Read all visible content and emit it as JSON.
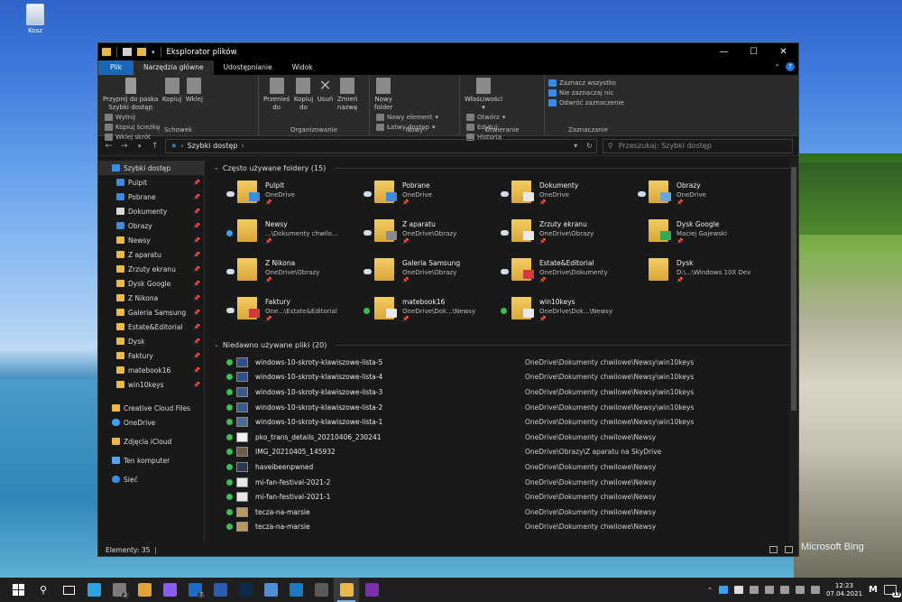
{
  "desktop": {
    "recycle_label": "Kosz",
    "wallpaper_credit": "Microsoft Bing"
  },
  "window": {
    "title": "Eksplorator plików",
    "controls": {
      "minimize": "—",
      "maximize": "☐",
      "close": "✕"
    }
  },
  "tabs": [
    {
      "label": "Plik",
      "kind": "file"
    },
    {
      "label": "Narzędzia główne",
      "kind": "active"
    },
    {
      "label": "Udostępnianie",
      "kind": ""
    },
    {
      "label": "Widok",
      "kind": ""
    }
  ],
  "ribbon": {
    "schowek": {
      "label": "Schowek",
      "pin_label_1": "Przypnij do paska",
      "pin_label_2": "Szybki dostęp",
      "copy": "Kopiuj",
      "paste": "Wklej",
      "cut": "Wytnij",
      "copy_path": "Kopiuj ścieżkę",
      "paste_shortcut": "Wklej skrót"
    },
    "organizowanie": {
      "label": "Organizowanie",
      "move_1": "Przenieś",
      "move_2": "do",
      "copy_to_1": "Kopiuj",
      "copy_to_2": "do",
      "delete": "Usuń",
      "rename_1": "Zmień",
      "rename_2": "nazwę"
    },
    "nowy": {
      "label": "Nowy",
      "new_folder_1": "Nowy",
      "new_folder_2": "folder",
      "new_item": "Nowy element",
      "easy_access": "Łatwy dostęp"
    },
    "otwieranie": {
      "label": "Otwieranie",
      "properties": "Właściwości",
      "open": "Otwórz",
      "edit": "Edytuj",
      "history": "Historia"
    },
    "zaznaczanie": {
      "label": "Zaznaczanie",
      "select_all": "Zaznacz wszystko",
      "select_none": "Nie zaznaczaj nic",
      "invert": "Odwróć zaznaczenie"
    }
  },
  "address": {
    "path": "Szybki dostęp",
    "search_placeholder": "Przeszukaj: Szybki dostęp"
  },
  "sidebar": {
    "quick_access": "Szybki dostęp",
    "items": [
      {
        "label": "Pulpit",
        "icon": "blue"
      },
      {
        "label": "Pobrane",
        "icon": "blue"
      },
      {
        "label": "Dokumenty",
        "icon": "doc"
      },
      {
        "label": "Obrazy",
        "icon": "blue"
      },
      {
        "label": "Newsy",
        "icon": ""
      },
      {
        "label": "Z aparatu",
        "icon": ""
      },
      {
        "label": "Zrzuty ekranu",
        "icon": ""
      },
      {
        "label": "Dysk Google",
        "icon": ""
      },
      {
        "label": "Z Nikona",
        "icon": ""
      },
      {
        "label": "Galeria Samsung",
        "icon": ""
      },
      {
        "label": "Estate&Editorial",
        "icon": ""
      },
      {
        "label": "Dysk",
        "icon": ""
      },
      {
        "label": "Faktury",
        "icon": ""
      },
      {
        "label": "matebook16",
        "icon": ""
      },
      {
        "label": "win10keys",
        "icon": ""
      }
    ],
    "roots": [
      {
        "label": "Creative Cloud Files",
        "icon": ""
      },
      {
        "label": "OneDrive",
        "icon": "cloud"
      },
      {
        "label": "Zdjęcia iCloud",
        "icon": ""
      },
      {
        "label": "Ten komputer",
        "icon": "pc"
      },
      {
        "label": "Sieć",
        "icon": "net"
      }
    ]
  },
  "frequent": {
    "header": "Często używane foldery (15)",
    "folders": [
      {
        "name": "Pulpit",
        "sub": "OneDrive",
        "status": "cloud",
        "overlay": "#3d8be0"
      },
      {
        "name": "Pobrane",
        "sub": "OneDrive",
        "status": "cloud",
        "overlay": "#3d8be0"
      },
      {
        "name": "Dokumenty",
        "sub": "OneDrive",
        "status": "cloud",
        "overlay": "#e8e8e8"
      },
      {
        "name": "Obrazy",
        "sub": "OneDrive",
        "status": "cloud",
        "overlay": "#6aa6d8"
      },
      {
        "name": "Newsy",
        "sub": "...\\Dokumenty chwilo...",
        "status": "sync",
        "overlay": ""
      },
      {
        "name": "Z aparatu",
        "sub": "OneDrive\\Obrazy",
        "status": "cloud",
        "overlay": "#8a8a8a"
      },
      {
        "name": "Zrzuty ekranu",
        "sub": "OneDrive\\Obrazy",
        "status": "cloud",
        "overlay": "#e8e8e8"
      },
      {
        "name": "Dysk Google",
        "sub": "Maciej Gajewski",
        "status": "",
        "overlay": "#34a853"
      },
      {
        "name": "Z Nikona",
        "sub": "OneDrive\\Obrazy",
        "status": "cloud",
        "overlay": ""
      },
      {
        "name": "Galeria Samsung",
        "sub": "OneDrive\\Obrazy",
        "status": "cloud",
        "overlay": ""
      },
      {
        "name": "Estate&Editorial",
        "sub": "OneDrive\\Dokumenty",
        "status": "cloud",
        "overlay": "#d23b3b"
      },
      {
        "name": "Dysk",
        "sub": "D:\\...\\Windows 10X Dev",
        "status": "",
        "overlay": ""
      },
      {
        "name": "Faktury",
        "sub": "One...\\Estate&Editorial",
        "status": "cloud",
        "overlay": "#d23b3b"
      },
      {
        "name": "matebook16",
        "sub": "OneDrive\\Dok...\\Newsy",
        "status": "ok",
        "overlay": "#e8e8e8"
      },
      {
        "name": "win10keys",
        "sub": "OneDrive\\Dok...\\Newsy",
        "status": "ok",
        "overlay": "#e8e8e8"
      }
    ]
  },
  "recent": {
    "header": "Niedawno używane pliki (20)",
    "files": [
      {
        "name": "windows-10-skroty-klawiszowe-lista-5",
        "path": "OneDrive\\Dokumenty chwilowe\\Newsy\\win10keys",
        "thumb": "#2d4f8a"
      },
      {
        "name": "windows-10-skroty-klawiszowe-lista-4",
        "path": "OneDrive\\Dokumenty chwilowe\\Newsy\\win10keys",
        "thumb": "#2d4f8a"
      },
      {
        "name": "windows-10-skroty-klawiszowe-lista-3",
        "path": "OneDrive\\Dokumenty chwilowe\\Newsy\\win10keys",
        "thumb": "#39598f"
      },
      {
        "name": "windows-10-skroty-klawiszowe-lista-2",
        "path": "OneDrive\\Dokumenty chwilowe\\Newsy\\win10keys",
        "thumb": "#39598f"
      },
      {
        "name": "windows-10-skroty-klawiszowe-lista-1",
        "path": "OneDrive\\Dokumenty chwilowe\\Newsy\\win10keys",
        "thumb": "#4a6a9a"
      },
      {
        "name": "pko_trans_details_20210406_230241",
        "path": "OneDrive\\Dokumenty chwilowe\\Newsy",
        "thumb": "#f2f2f2"
      },
      {
        "name": "IMG_20210405_145932",
        "path": "OneDrive\\Obrazy\\Z aparatu na SkyDrive",
        "thumb": "#6c5d4a"
      },
      {
        "name": "haveibeenpwned",
        "path": "OneDrive\\Dokumenty chwilowe\\Newsy",
        "thumb": "#2a3b4f"
      },
      {
        "name": "mi-fan-festival-2021-2",
        "path": "OneDrive\\Dokumenty chwilowe\\Newsy",
        "thumb": "#e6e6e6"
      },
      {
        "name": "mi-fan-festival-2021-1",
        "path": "OneDrive\\Dokumenty chwilowe\\Newsy",
        "thumb": "#e6e6e6"
      },
      {
        "name": "tecza-na-marsie",
        "path": "OneDrive\\Dokumenty chwilowe\\Newsy",
        "thumb": "#b99a5a"
      },
      {
        "name": "tecza-na-marsie",
        "path": "OneDrive\\Dokumenty chwilowe\\Newsy",
        "thumb": "#b99a5a"
      }
    ]
  },
  "status": {
    "items": "Elementy: 35"
  },
  "taskbar": {
    "apps": [
      {
        "name": "start",
        "color": "#ffffff",
        "badge": ""
      },
      {
        "name": "search",
        "color": "#ffffff",
        "badge": ""
      },
      {
        "name": "task-view",
        "color": "#ffffff",
        "badge": ""
      },
      {
        "name": "edge",
        "color": "#2fa1e0",
        "badge": ""
      },
      {
        "name": "mail",
        "color": "#7b7b7b",
        "badge": "2"
      },
      {
        "name": "slack",
        "color": "#e0a23a",
        "badge": ""
      },
      {
        "name": "messenger",
        "color": "#8a5cf0",
        "badge": ""
      },
      {
        "name": "outlook",
        "color": "#1f6cc7",
        "badge": "7"
      },
      {
        "name": "word",
        "color": "#2b5cb4",
        "badge": ""
      },
      {
        "name": "photoshop",
        "color": "#0c2a4a",
        "badge": ""
      },
      {
        "name": "chrome",
        "color": "#4f8fd8",
        "badge": ""
      },
      {
        "name": "trello",
        "color": "#1f79bf",
        "badge": ""
      },
      {
        "name": "calculator",
        "color": "#5a5a5a",
        "badge": ""
      },
      {
        "name": "explorer",
        "color": "#e9b949",
        "badge": ""
      },
      {
        "name": "onenote",
        "color": "#7b2fa8",
        "badge": ""
      }
    ],
    "time": "12:23",
    "date": "07.04.2021",
    "notifications": "13"
  }
}
